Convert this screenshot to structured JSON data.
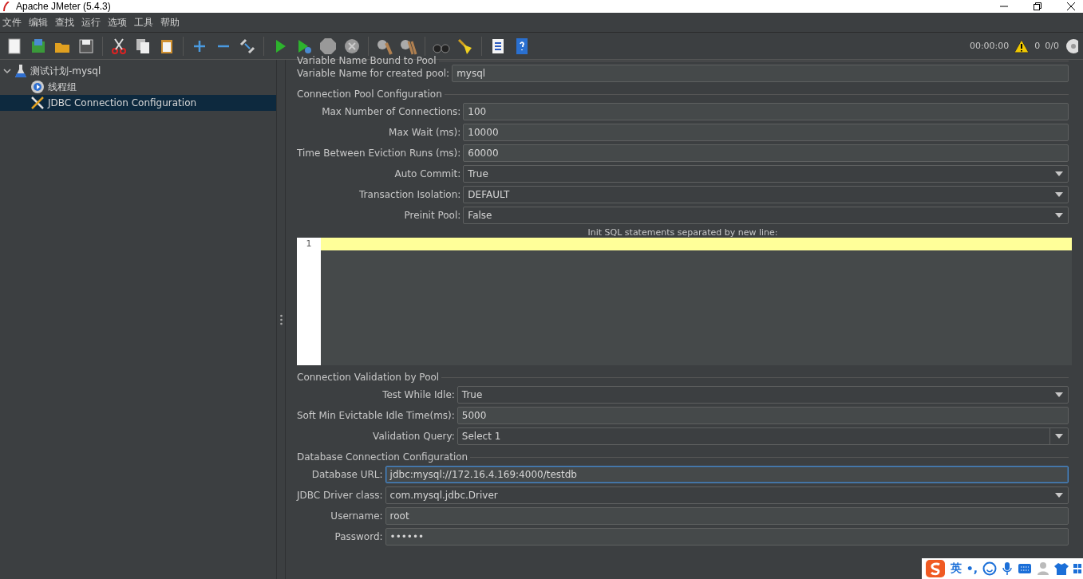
{
  "window": {
    "title": "Apache JMeter (5.4.3)"
  },
  "menu": [
    "文件",
    "编辑",
    "查找",
    "运行",
    "选项",
    "工具",
    "帮助"
  ],
  "status": {
    "timer": "00:00:00",
    "warnings": "0",
    "threads": "0/0"
  },
  "tree": [
    {
      "label": "测试计划-mysql",
      "kind": "plan",
      "expanded": true,
      "selected": false,
      "children": [
        {
          "label": "线程组",
          "kind": "threads",
          "selected": false
        },
        {
          "label": "JDBC Connection Configuration",
          "kind": "config",
          "selected": true
        }
      ]
    }
  ],
  "sections": [
    {
      "title": "Variable Name Bound to Pool",
      "fields": [
        {
          "label": "Variable Name for created pool:",
          "value": "mysql",
          "kind": "text",
          "focused": false
        }
      ]
    },
    {
      "title": "Connection Pool Configuration",
      "fields": [
        {
          "label": "Max Number of Connections:",
          "value": "100",
          "kind": "text",
          "focused": false
        },
        {
          "label": "Max Wait (ms):",
          "value": "10000",
          "kind": "text",
          "focused": false
        },
        {
          "label": "Time Between Eviction Runs (ms):",
          "value": "60000",
          "kind": "text",
          "focused": false
        },
        {
          "label": "Auto Commit:",
          "value": "True",
          "kind": "combo",
          "focused": false
        },
        {
          "label": "Transaction Isolation:",
          "value": "DEFAULT",
          "kind": "combo",
          "focused": false
        },
        {
          "label": "Preinit Pool:",
          "value": "False",
          "kind": "combo",
          "focused": false
        }
      ],
      "editor": {
        "title": "Init SQL statements separated by new line:",
        "line_numbers": [
          "1"
        ]
      }
    },
    {
      "title": "Connection Validation by Pool",
      "fields": [
        {
          "label": "Test While Idle:",
          "value": "True",
          "kind": "combo",
          "focused": false
        },
        {
          "label": "Soft Min Evictable Idle Time(ms):",
          "value": "5000",
          "kind": "text",
          "focused": false
        },
        {
          "label": "Validation Query:",
          "value": "Select 1",
          "kind": "editable-combo",
          "focused": false
        }
      ]
    },
    {
      "title": "Database Connection Configuration",
      "fields": [
        {
          "label": "Database URL:",
          "value": "jdbc:mysql://172.16.4.169:4000/testdb",
          "kind": "text",
          "focused": true
        },
        {
          "label": "JDBC Driver class:",
          "value": "com.mysql.jdbc.Driver",
          "kind": "combo",
          "focused": false
        },
        {
          "label": "Username:",
          "value": "root",
          "kind": "text",
          "focused": false
        },
        {
          "label": "Password:",
          "value": "••••••",
          "kind": "text",
          "focused": false
        }
      ]
    }
  ],
  "ime_bar": {
    "language": "英",
    "punctuation": "•,"
  }
}
